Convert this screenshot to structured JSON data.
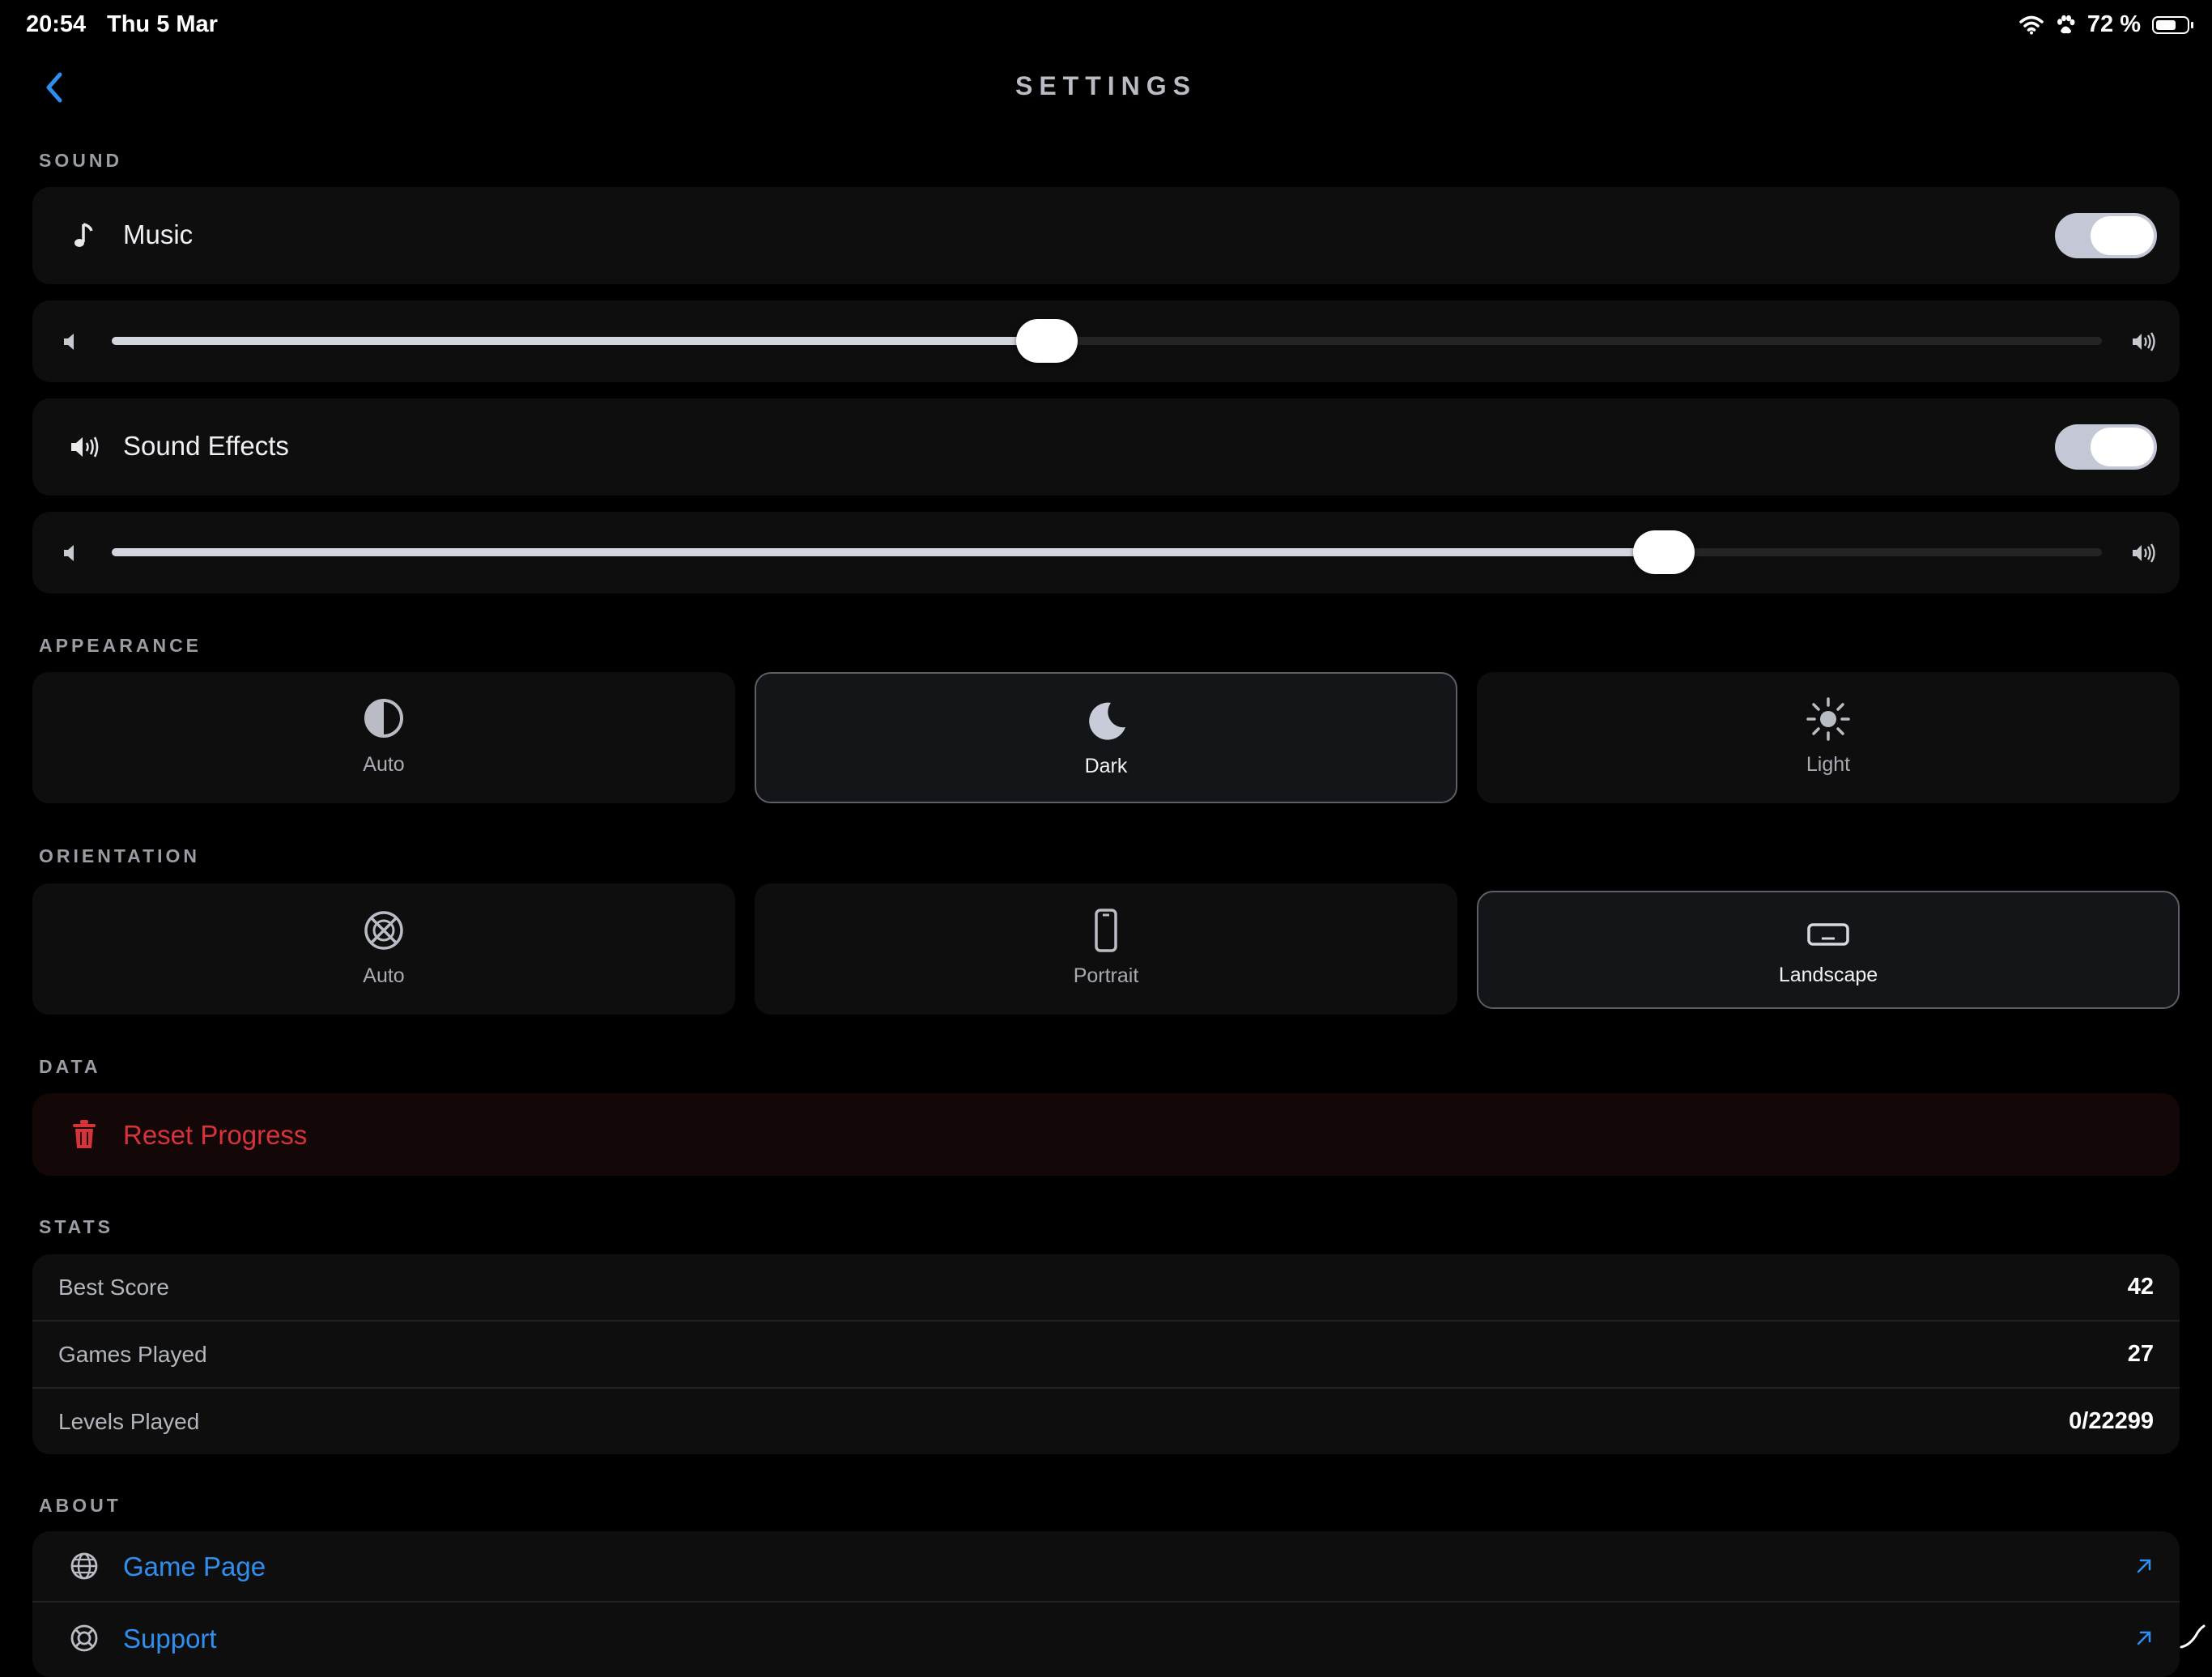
{
  "status_bar": {
    "time": "20:54",
    "date": "Thu 5 Mar",
    "battery_text": "72 %",
    "battery_level": 0.72
  },
  "header": {
    "title": "SETTINGS"
  },
  "sections": {
    "sound": "SOUND",
    "appearance": "APPEARANCE",
    "orientation": "ORIENTATION",
    "data": "DATA",
    "stats": "STATS",
    "about": "ABOUT"
  },
  "sound": {
    "music": {
      "label": "Music",
      "enabled": true,
      "volume": 0.47
    },
    "effects": {
      "label": "Sound Effects",
      "enabled": true,
      "volume": 0.78
    }
  },
  "appearance": {
    "options": [
      {
        "label": "Auto",
        "icon": "half-circle-icon"
      },
      {
        "label": "Dark",
        "icon": "moon-icon"
      },
      {
        "label": "Light",
        "icon": "sun-icon"
      }
    ],
    "selected": "Dark"
  },
  "orientation": {
    "options": [
      {
        "label": "Auto",
        "icon": "rotation-lock-icon"
      },
      {
        "label": "Portrait",
        "icon": "phone-portrait-icon"
      },
      {
        "label": "Landscape",
        "icon": "phone-landscape-icon"
      }
    ],
    "selected": "Landscape"
  },
  "data": {
    "reset_label": "Reset Progress"
  },
  "stats": {
    "rows": [
      {
        "label": "Best Score",
        "value": "42"
      },
      {
        "label": "Games Played",
        "value": "27"
      },
      {
        "label": "Levels Played",
        "value": "0/22299"
      }
    ]
  },
  "about": {
    "rows": [
      {
        "label": "Game Page",
        "icon": "globe-icon"
      },
      {
        "label": "Support",
        "icon": "lifebuoy-icon"
      }
    ]
  },
  "colors": {
    "background": "#000000",
    "card": "#0e0e0f",
    "accent_link": "#2f8ff0",
    "danger": "#d6333a",
    "toggle_on": "#c4c8d6"
  }
}
